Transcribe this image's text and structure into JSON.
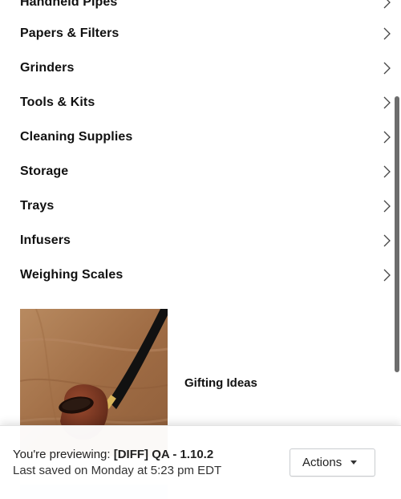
{
  "menu": {
    "items": [
      {
        "label": "Handheld Pipes"
      },
      {
        "label": "Papers & Filters"
      },
      {
        "label": "Grinders"
      },
      {
        "label": "Tools & Kits"
      },
      {
        "label": "Cleaning Supplies"
      },
      {
        "label": "Storage"
      },
      {
        "label": "Trays"
      },
      {
        "label": "Infusers"
      },
      {
        "label": "Weighing Scales"
      }
    ]
  },
  "promo": {
    "title": "Gifting Ideas",
    "image_icon": "pipe-photo"
  },
  "preview_bar": {
    "prefix": "You're previewing:",
    "theme_name": "[DIFF] QA - 1.10.2",
    "last_saved": "Last saved on Monday at 5:23 pm EDT",
    "actions_label": "Actions"
  },
  "colors": {
    "text": "#111111",
    "scrollbar": "#6d6d6d",
    "wood": "#a4744d"
  }
}
